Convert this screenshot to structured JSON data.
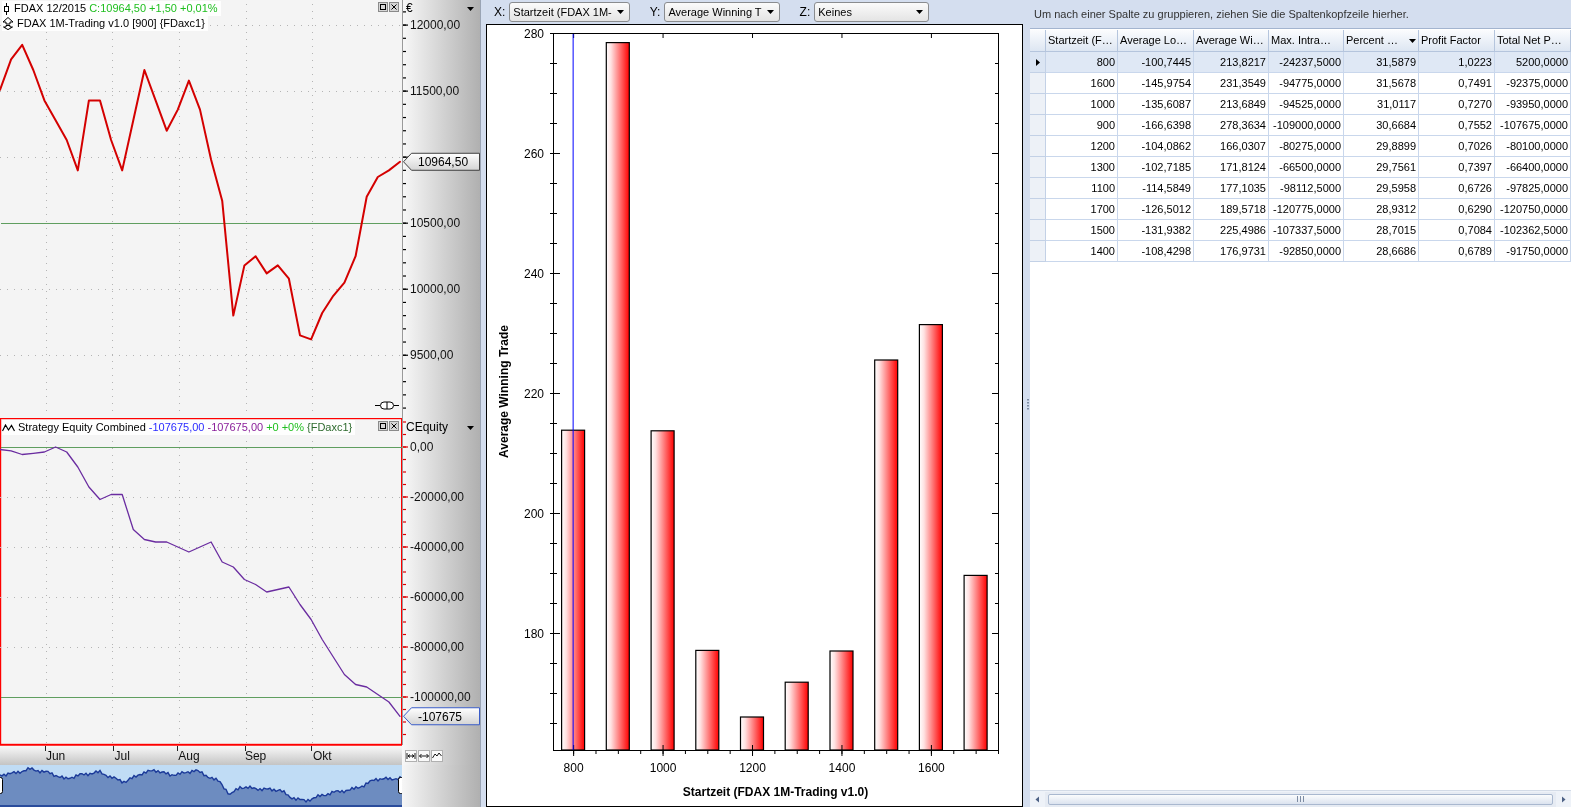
{
  "price_pane": {
    "selected": false,
    "legend": [
      {
        "kind": "instrument",
        "parts": [
          {
            "text": "FDAX 12/2015",
            "color": "#000000"
          },
          {
            "text": "C:10964,50 +1,50 +0,01%",
            "color": "#1fbf1f"
          }
        ]
      },
      {
        "kind": "strategy",
        "parts": [
          {
            "text": "FDAX 1M-Trading v1.0 [900] {FDaxc1}",
            "color": "#000000"
          }
        ]
      }
    ],
    "axis_unit": "€",
    "last_value": "10964,50",
    "chart_data": {
      "type": "line",
      "grid": true,
      "categories": [
        null,
        null,
        null,
        null,
        null,
        null,
        null,
        null,
        null,
        null,
        null,
        null,
        null,
        null,
        null,
        null,
        null,
        null,
        null,
        null,
        null,
        null,
        null,
        null,
        null,
        null,
        null,
        null,
        null,
        null,
        null,
        null,
        null,
        null,
        null,
        null,
        null
      ],
      "series": [
        {
          "color": "#d40000",
          "values": [
            11510,
            11740,
            11850,
            11660,
            11430,
            11280,
            11130,
            10900,
            11430,
            11430,
            11130,
            10900,
            11280,
            11660,
            11430,
            11200,
            11360,
            11580,
            11360,
            10980,
            10670,
            9800,
            10180,
            10250,
            10120,
            10180,
            10080,
            9650,
            9620,
            9820,
            9950,
            10050,
            10250,
            10700,
            10850,
            10900,
            10965
          ]
        }
      ],
      "ylim": [
        9040,
        12190
      ],
      "yticks": [
        {
          "value": 9500,
          "label": "9500,00"
        },
        {
          "value": 10000,
          "label": "10000,00"
        },
        {
          "value": 10500,
          "label": "10500,00"
        },
        {
          "value": 11500,
          "label": "11500,00"
        },
        {
          "value": 12000,
          "label": "12000,00"
        }
      ],
      "ref_lines": [
        {
          "axis": "y",
          "value": 10500
        }
      ]
    }
  },
  "equity_pane": {
    "selected": true,
    "legend": [
      {
        "kind": "equity",
        "parts": [
          {
            "text": "Strategy Equity Combined",
            "color": "#000000"
          },
          {
            "text": "-107675,00",
            "color": "#2b2bff"
          },
          {
            "text": "-107675,00",
            "color": "#8a1f9a"
          },
          {
            "text": "+0",
            "color": "#1fbf1f"
          },
          {
            "text": "+0%",
            "color": "#1fbf1f"
          },
          {
            "text": "{FDaxc1}",
            "color": "#2e6b2e"
          }
        ]
      }
    ],
    "axis_unit": "CEquity",
    "last_value": "-107675",
    "chart_data": {
      "type": "line",
      "grid": true,
      "categories": [
        null,
        null,
        null,
        null,
        null,
        "Jun",
        null,
        null,
        null,
        null,
        null,
        "Jul",
        null,
        null,
        null,
        null,
        null,
        "Aug",
        null,
        null,
        null,
        null,
        null,
        "Sep",
        null,
        null,
        null,
        null,
        null,
        "Okt",
        null,
        null,
        null,
        null,
        null,
        null,
        null
      ],
      "series": [
        {
          "color": "#6a2ca0",
          "values": [
            -1000,
            -1500,
            -3000,
            -2500,
            -2000,
            0,
            -2000,
            -8000,
            -16000,
            -21000,
            -19000,
            -19000,
            -33000,
            -37000,
            -38000,
            -38000,
            -40000,
            -42000,
            -40000,
            -38000,
            -46000,
            -48000,
            -53000,
            -55000,
            -58000,
            -57000,
            -56000,
            -63000,
            -69000,
            -77000,
            -84000,
            -91000,
            -95000,
            -96000,
            -99000,
            -102000,
            -107700
          ]
        }
      ],
      "ylim": [
        -119200,
        12400
      ],
      "yticks": [
        {
          "value": 0,
          "label": "0,00"
        },
        {
          "value": -20000,
          "label": "-20000,00"
        },
        {
          "value": -40000,
          "label": "-40000,00"
        },
        {
          "value": -60000,
          "label": "-60000,00"
        },
        {
          "value": -80000,
          "label": "-80000,00"
        },
        {
          "value": -100000,
          "label": "-100000,00"
        }
      ],
      "ref_lines": [
        {
          "axis": "y",
          "value": 0
        },
        {
          "axis": "y",
          "value": -100000
        }
      ]
    }
  },
  "chart_toolbar": {
    "axis_selectors": [
      {
        "label": "X:",
        "value": "Startzeit (FDAX 1M-"
      },
      {
        "label": "Y:",
        "value": "Average Winning T"
      },
      {
        "label": "Z:",
        "value": "Keines"
      }
    ]
  },
  "bar_chart": {
    "chart_data": {
      "type": "bar",
      "xlabel": "Startzeit (FDAX 1M-Trading v1.0)",
      "ylabel": "Average Winning Trade",
      "x": [
        800,
        900,
        1000,
        1100,
        1200,
        1300,
        1400,
        1500,
        1600,
        1700
      ],
      "values": [
        213.8,
        278.4,
        213.7,
        177.1,
        166.0,
        171.8,
        177.0,
        225.5,
        231.4,
        189.6
      ],
      "xlim": [
        755,
        1750
      ],
      "ylim": [
        160.5,
        280
      ],
      "xticks": [
        800,
        1000,
        1200,
        1400,
        1600
      ],
      "yticks": [
        180,
        200,
        220,
        240,
        260,
        280
      ],
      "ref_lines": [
        {
          "axis": "x",
          "value": 800
        }
      ]
    }
  },
  "results_grid": {
    "group_panel_hint": "Um nach einer Spalte zu gruppieren, ziehen Sie die Spaltenkopfzeile hierher.",
    "columns": [
      {
        "label": "Startzeit (F…",
        "sorted_descending": false
      },
      {
        "label": "Average Lo…",
        "sorted_descending": false
      },
      {
        "label": "Average Wi…",
        "sorted_descending": false
      },
      {
        "label": "Max. Intra…",
        "sorted_descending": false
      },
      {
        "label": "Percent …",
        "sorted_descending": true
      },
      {
        "label": "Profit Factor",
        "sorted_descending": false
      },
      {
        "label": "Total Net P…",
        "sorted_descending": false
      }
    ],
    "rows": [
      {
        "selected": true,
        "cells": [
          "800",
          "-100,7445",
          "213,8217",
          "-24237,5000",
          "31,5879",
          "1,0223",
          "5200,0000"
        ]
      },
      {
        "selected": false,
        "cells": [
          "1600",
          "-145,9754",
          "231,3549",
          "-94775,0000",
          "31,5678",
          "0,7491",
          "-92375,0000"
        ]
      },
      {
        "selected": false,
        "cells": [
          "1000",
          "-135,6087",
          "213,6849",
          "-94525,0000",
          "31,0117",
          "0,7270",
          "-93950,0000"
        ]
      },
      {
        "selected": false,
        "cells": [
          "900",
          "-166,6398",
          "278,3634",
          "-109000,0000",
          "30,6684",
          "0,7552",
          "-107675,0000"
        ]
      },
      {
        "selected": false,
        "cells": [
          "1200",
          "-104,0862",
          "166,0307",
          "-80275,0000",
          "29,8899",
          "0,7026",
          "-80100,0000"
        ]
      },
      {
        "selected": false,
        "cells": [
          "1300",
          "-102,7185",
          "171,8124",
          "-66500,0000",
          "29,7561",
          "0,7397",
          "-66400,0000"
        ]
      },
      {
        "selected": false,
        "cells": [
          "1100",
          "-114,5849",
          "177,1035",
          "-98112,5000",
          "29,5958",
          "0,6726",
          "-97825,0000"
        ]
      },
      {
        "selected": false,
        "cells": [
          "1700",
          "-126,5012",
          "189,5718",
          "-120775,0000",
          "28,9312",
          "0,6290",
          "-120750,0000"
        ]
      },
      {
        "selected": false,
        "cells": [
          "1500",
          "-131,9382",
          "225,4986",
          "-107337,5000",
          "28,7015",
          "0,7084",
          "-102362,5000"
        ]
      },
      {
        "selected": false,
        "cells": [
          "1400",
          "-108,4298",
          "176,9731",
          "-92850,0000",
          "28,6686",
          "0,6789",
          "-91750,0000"
        ]
      }
    ]
  }
}
